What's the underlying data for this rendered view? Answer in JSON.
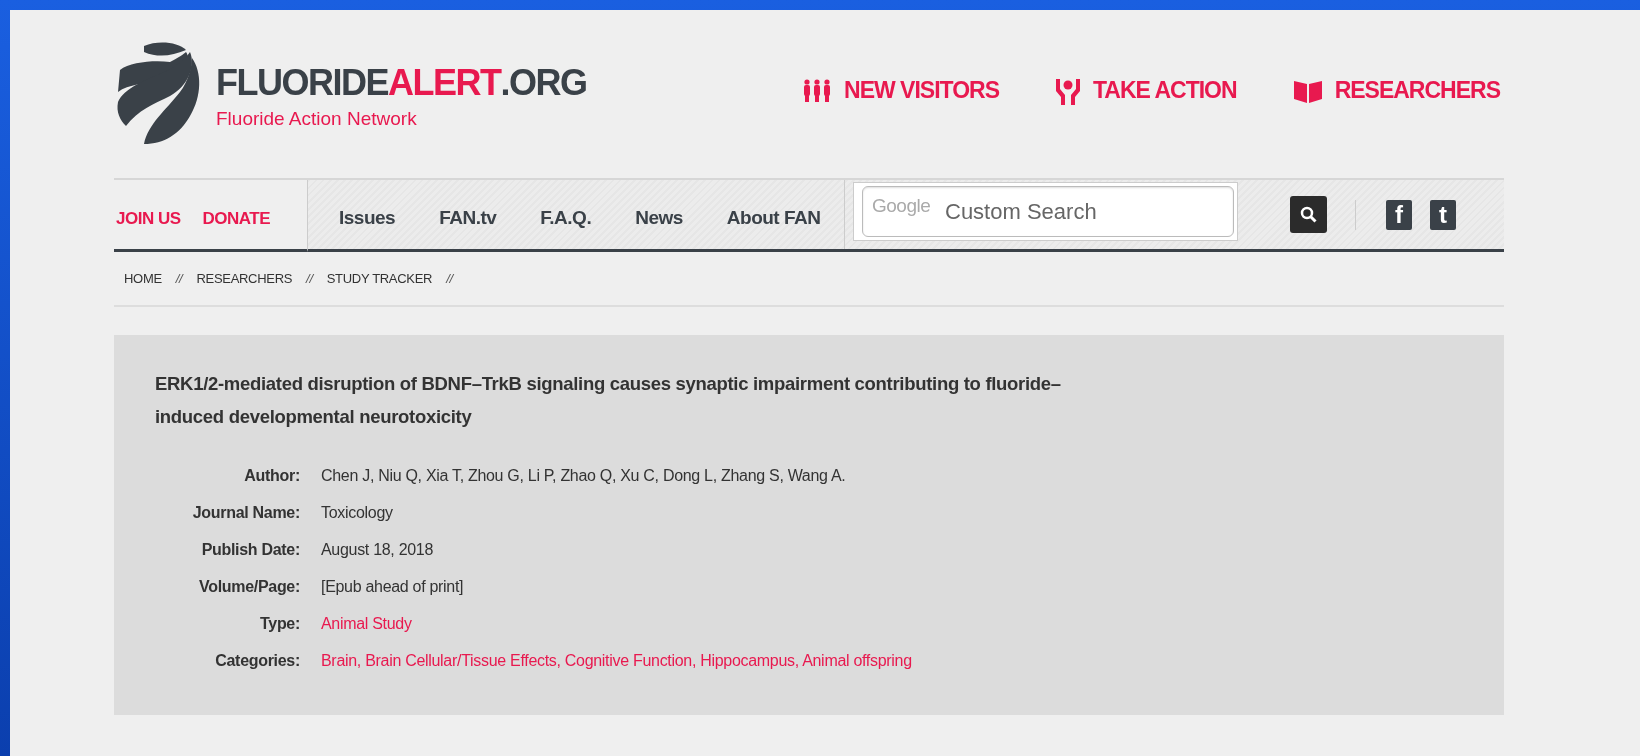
{
  "logo": {
    "name": "FLUORIDE",
    "highlight": "ALERT",
    "suffix": ".ORG",
    "tagline": "Fluoride Action Network"
  },
  "top_links": [
    "NEW VISITORS",
    "TAKE ACTION",
    "RESEARCHERS"
  ],
  "nav": {
    "side_links": [
      "JOIN US",
      "DONATE"
    ],
    "menu": [
      "Issues",
      "FAN.tv",
      "F.A.Q.",
      "News",
      "About FAN"
    ],
    "search": {
      "brand": "Google",
      "placeholder": "Custom Search"
    },
    "social": [
      "f",
      "t"
    ]
  },
  "breadcrumb": [
    "HOME",
    "//",
    "RESEARCHERS",
    "//",
    "STUDY TRACKER",
    "//"
  ],
  "study": {
    "title": "ERK1/2-mediated disruption of BDNF–TrkB signaling causes synaptic impairment contributing to fluoride– induced developmental neurotoxicity",
    "fields": [
      {
        "label": "Author:",
        "value": "Chen J, Niu Q, Xia T, Zhou G, Li P, Zhao Q, Xu C, Dong L, Zhang S, Wang A.",
        "kind": "text"
      },
      {
        "label": "Journal Name:",
        "value": "Toxicology",
        "kind": "text"
      },
      {
        "label": "Publish Date:",
        "value": "August 18, 2018",
        "kind": "text"
      },
      {
        "label": "Volume/Page:",
        "value": "[Epub ahead of print]",
        "kind": "text"
      },
      {
        "label": "Type:",
        "value": "Animal Study",
        "kind": "link"
      },
      {
        "label": "Categories:",
        "value": "Brain, Brain Cellular/Tissue Effects, Cognitive Function, Hippocampus, Animal offspring",
        "kind": "link"
      }
    ]
  }
}
